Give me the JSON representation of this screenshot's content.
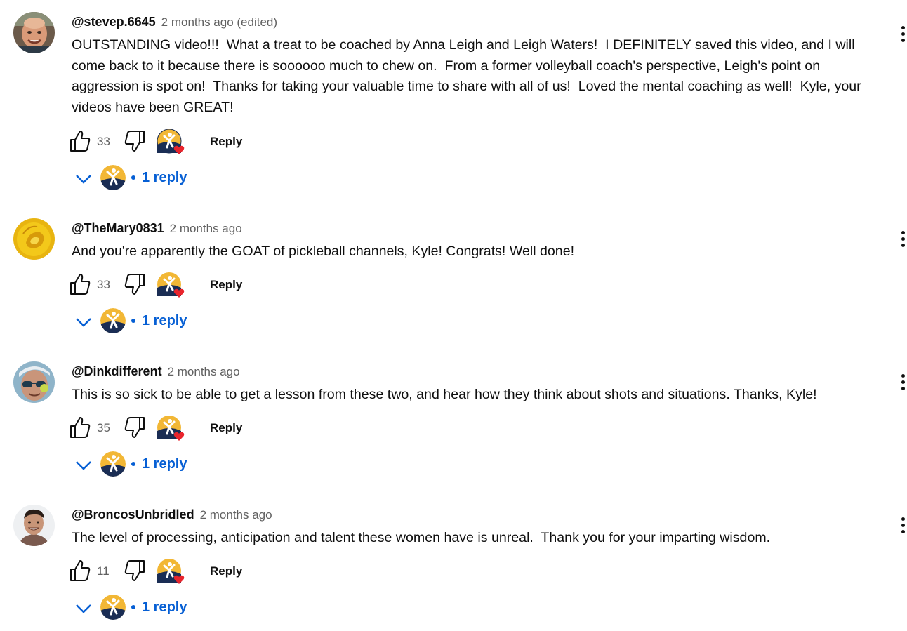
{
  "comments": [
    {
      "author": "@stevep.6645",
      "time": "2 months ago (edited)",
      "text": "OUTSTANDING video!!!  What a treat to be coached by Anna Leigh and Leigh Waters!  I DEFINITELY saved this video, and I will come back to it because there is soooooo much to chew on.  From a former volleyball coach's perspective, Leigh's point on aggression is spot on!  Thanks for taking your valuable time to share with all of us!  Loved the mental coaching as well!  Kyle, your videos have been GREAT!",
      "likes": "33",
      "reply_label": "Reply",
      "replies_label": "1 reply",
      "avatar_icon": "bald-man-photo-avatar"
    },
    {
      "author": "@TheMary0831",
      "time": "2 months ago",
      "text": "And you're apparently the GOAT of pickleball channels, Kyle! Congrats! Well done!",
      "likes": "33",
      "reply_label": "Reply",
      "replies_label": "1 reply",
      "avatar_icon": "yellow-rose-avatar"
    },
    {
      "author": "@Dinkdifferent",
      "time": "2 months ago",
      "text": "This is so sick to be able to get a lesson from these two, and hear how they think about shots and situations. Thanks, Kyle!",
      "likes": "35",
      "reply_label": "Reply",
      "replies_label": "1 reply",
      "avatar_icon": "man-sunglasses-avatar"
    },
    {
      "author": "@BroncosUnbridled",
      "time": "2 months ago",
      "text": "The level of processing, anticipation and talent these women have is unreal.  Thank you for your imparting wisdom.",
      "likes": "11",
      "reply_label": "Reply",
      "replies_label": "1 reply",
      "avatar_icon": "smiling-man-avatar"
    }
  ],
  "colors": {
    "link_blue": "#065fd4",
    "meta_gray": "#606060",
    "heart_red": "#e9242c"
  },
  "icons": [
    "thumbs-up-icon",
    "thumbs-down-icon",
    "creator-heart-icon",
    "chevron-down-icon",
    "more-vert-icon"
  ]
}
